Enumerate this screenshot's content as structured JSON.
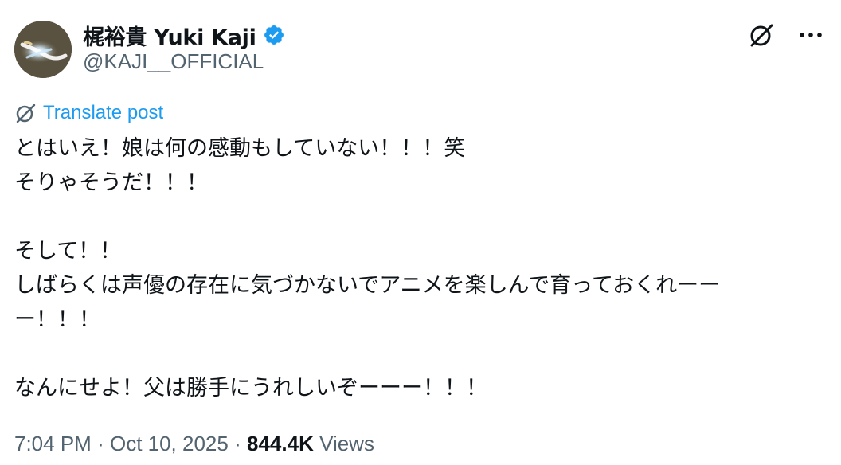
{
  "author": {
    "display_name": "梶裕貴 Yuki Kaji",
    "handle": "@KAJI__OFFICIAL",
    "verified": true,
    "avatar_icon": "avatar-image"
  },
  "actions": {
    "grok_icon": "grok-icon",
    "more_icon": "more-options-icon"
  },
  "translate": {
    "label": "Translate post",
    "icon": "grok-icon",
    "color": "#1d9bf0"
  },
  "post": {
    "lines": [
      "とはいえ！娘は何の感動もしていない！！！笑",
      "そりゃそうだ！！！",
      "",
      "そして！！",
      "しばらくは声優の存在に気づかないでアニメを楽しんで育っておくれーー",
      "ー！！！",
      "",
      "なんにせよ！父は勝手にうれしいぞーーー！！！"
    ]
  },
  "meta": {
    "time": "7:04 PM",
    "date": "Oct 10, 2025",
    "separator": "·",
    "views_count": "844.4K",
    "views_label": "Views"
  },
  "colors": {
    "text": "#0f1419",
    "secondary": "#536471",
    "accent": "#1d9bf0",
    "verified": "#1d9bf0"
  }
}
